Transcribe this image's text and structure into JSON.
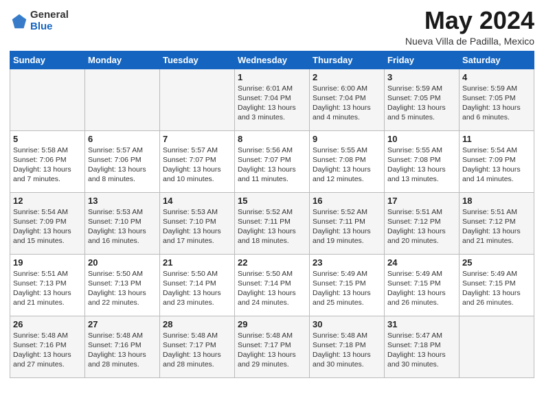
{
  "header": {
    "logo_general": "General",
    "logo_blue": "Blue",
    "month_title": "May 2024",
    "subtitle": "Nueva Villa de Padilla, Mexico"
  },
  "days_of_week": [
    "Sunday",
    "Monday",
    "Tuesday",
    "Wednesday",
    "Thursday",
    "Friday",
    "Saturday"
  ],
  "weeks": [
    [
      {
        "num": "",
        "info": ""
      },
      {
        "num": "",
        "info": ""
      },
      {
        "num": "",
        "info": ""
      },
      {
        "num": "1",
        "info": "Sunrise: 6:01 AM\nSunset: 7:04 PM\nDaylight: 13 hours and 3 minutes."
      },
      {
        "num": "2",
        "info": "Sunrise: 6:00 AM\nSunset: 7:04 PM\nDaylight: 13 hours and 4 minutes."
      },
      {
        "num": "3",
        "info": "Sunrise: 5:59 AM\nSunset: 7:05 PM\nDaylight: 13 hours and 5 minutes."
      },
      {
        "num": "4",
        "info": "Sunrise: 5:59 AM\nSunset: 7:05 PM\nDaylight: 13 hours and 6 minutes."
      }
    ],
    [
      {
        "num": "5",
        "info": "Sunrise: 5:58 AM\nSunset: 7:06 PM\nDaylight: 13 hours and 7 minutes."
      },
      {
        "num": "6",
        "info": "Sunrise: 5:57 AM\nSunset: 7:06 PM\nDaylight: 13 hours and 8 minutes."
      },
      {
        "num": "7",
        "info": "Sunrise: 5:57 AM\nSunset: 7:07 PM\nDaylight: 13 hours and 10 minutes."
      },
      {
        "num": "8",
        "info": "Sunrise: 5:56 AM\nSunset: 7:07 PM\nDaylight: 13 hours and 11 minutes."
      },
      {
        "num": "9",
        "info": "Sunrise: 5:55 AM\nSunset: 7:08 PM\nDaylight: 13 hours and 12 minutes."
      },
      {
        "num": "10",
        "info": "Sunrise: 5:55 AM\nSunset: 7:08 PM\nDaylight: 13 hours and 13 minutes."
      },
      {
        "num": "11",
        "info": "Sunrise: 5:54 AM\nSunset: 7:09 PM\nDaylight: 13 hours and 14 minutes."
      }
    ],
    [
      {
        "num": "12",
        "info": "Sunrise: 5:54 AM\nSunset: 7:09 PM\nDaylight: 13 hours and 15 minutes."
      },
      {
        "num": "13",
        "info": "Sunrise: 5:53 AM\nSunset: 7:10 PM\nDaylight: 13 hours and 16 minutes."
      },
      {
        "num": "14",
        "info": "Sunrise: 5:53 AM\nSunset: 7:10 PM\nDaylight: 13 hours and 17 minutes."
      },
      {
        "num": "15",
        "info": "Sunrise: 5:52 AM\nSunset: 7:11 PM\nDaylight: 13 hours and 18 minutes."
      },
      {
        "num": "16",
        "info": "Sunrise: 5:52 AM\nSunset: 7:11 PM\nDaylight: 13 hours and 19 minutes."
      },
      {
        "num": "17",
        "info": "Sunrise: 5:51 AM\nSunset: 7:12 PM\nDaylight: 13 hours and 20 minutes."
      },
      {
        "num": "18",
        "info": "Sunrise: 5:51 AM\nSunset: 7:12 PM\nDaylight: 13 hours and 21 minutes."
      }
    ],
    [
      {
        "num": "19",
        "info": "Sunrise: 5:51 AM\nSunset: 7:13 PM\nDaylight: 13 hours and 21 minutes."
      },
      {
        "num": "20",
        "info": "Sunrise: 5:50 AM\nSunset: 7:13 PM\nDaylight: 13 hours and 22 minutes."
      },
      {
        "num": "21",
        "info": "Sunrise: 5:50 AM\nSunset: 7:14 PM\nDaylight: 13 hours and 23 minutes."
      },
      {
        "num": "22",
        "info": "Sunrise: 5:50 AM\nSunset: 7:14 PM\nDaylight: 13 hours and 24 minutes."
      },
      {
        "num": "23",
        "info": "Sunrise: 5:49 AM\nSunset: 7:15 PM\nDaylight: 13 hours and 25 minutes."
      },
      {
        "num": "24",
        "info": "Sunrise: 5:49 AM\nSunset: 7:15 PM\nDaylight: 13 hours and 26 minutes."
      },
      {
        "num": "25",
        "info": "Sunrise: 5:49 AM\nSunset: 7:15 PM\nDaylight: 13 hours and 26 minutes."
      }
    ],
    [
      {
        "num": "26",
        "info": "Sunrise: 5:48 AM\nSunset: 7:16 PM\nDaylight: 13 hours and 27 minutes."
      },
      {
        "num": "27",
        "info": "Sunrise: 5:48 AM\nSunset: 7:16 PM\nDaylight: 13 hours and 28 minutes."
      },
      {
        "num": "28",
        "info": "Sunrise: 5:48 AM\nSunset: 7:17 PM\nDaylight: 13 hours and 28 minutes."
      },
      {
        "num": "29",
        "info": "Sunrise: 5:48 AM\nSunset: 7:17 PM\nDaylight: 13 hours and 29 minutes."
      },
      {
        "num": "30",
        "info": "Sunrise: 5:48 AM\nSunset: 7:18 PM\nDaylight: 13 hours and 30 minutes."
      },
      {
        "num": "31",
        "info": "Sunrise: 5:47 AM\nSunset: 7:18 PM\nDaylight: 13 hours and 30 minutes."
      },
      {
        "num": "",
        "info": ""
      }
    ]
  ]
}
